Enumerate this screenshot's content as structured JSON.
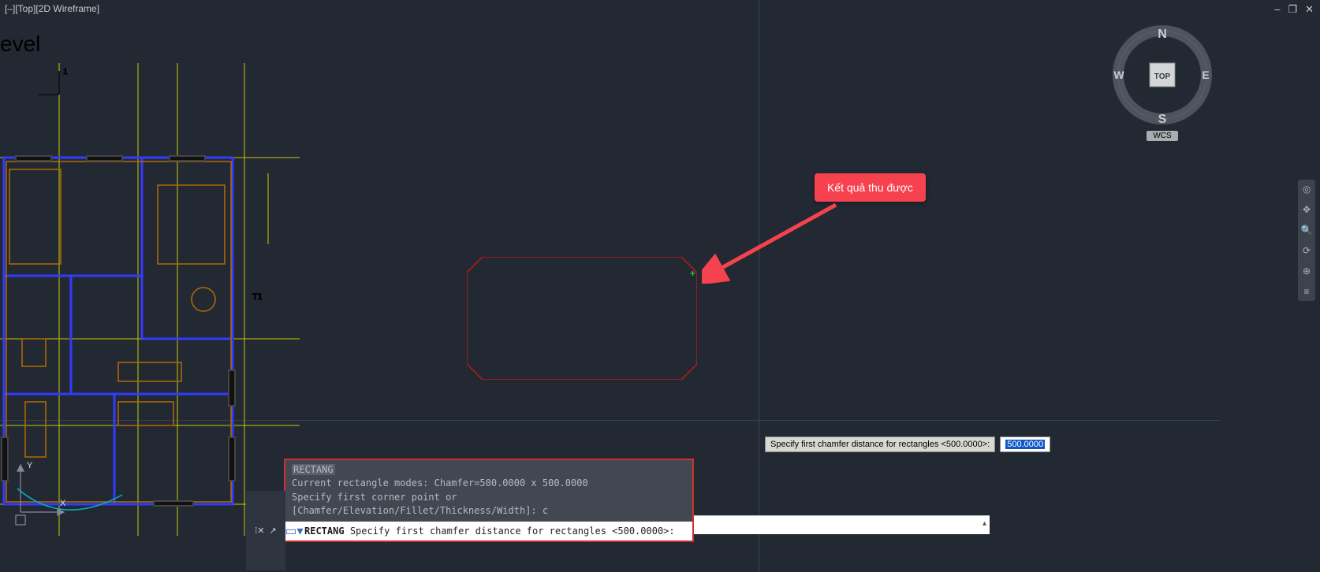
{
  "viewport_label": "[–][Top][2D Wireframe]",
  "window_controls": {
    "min": "–",
    "restore": "❐",
    "close": "✕"
  },
  "level_text": "evel",
  "callout_text": "Kết quả thu được",
  "viewcube": {
    "n": "N",
    "s": "S",
    "e": "E",
    "w": "W",
    "top": "TOP",
    "wcs": "WCS"
  },
  "dynamic_input": {
    "label": "Specify first chamfer distance for rectangles <500.0000>:",
    "value": "500.0000"
  },
  "cmd_history": {
    "l1": "RECTANG",
    "l2": "Current rectangle modes:  Chamfer=500.0000 x 500.0000",
    "l3": "Specify first corner point or [Chamfer/Elevation/Fillet/Thickness/Width]: c"
  },
  "cmd_prompt": {
    "cmd": "RECTANG",
    "text": "Specify first chamfer distance for rectangles <500.0000>:"
  },
  "floorplan_marker": "1"
}
